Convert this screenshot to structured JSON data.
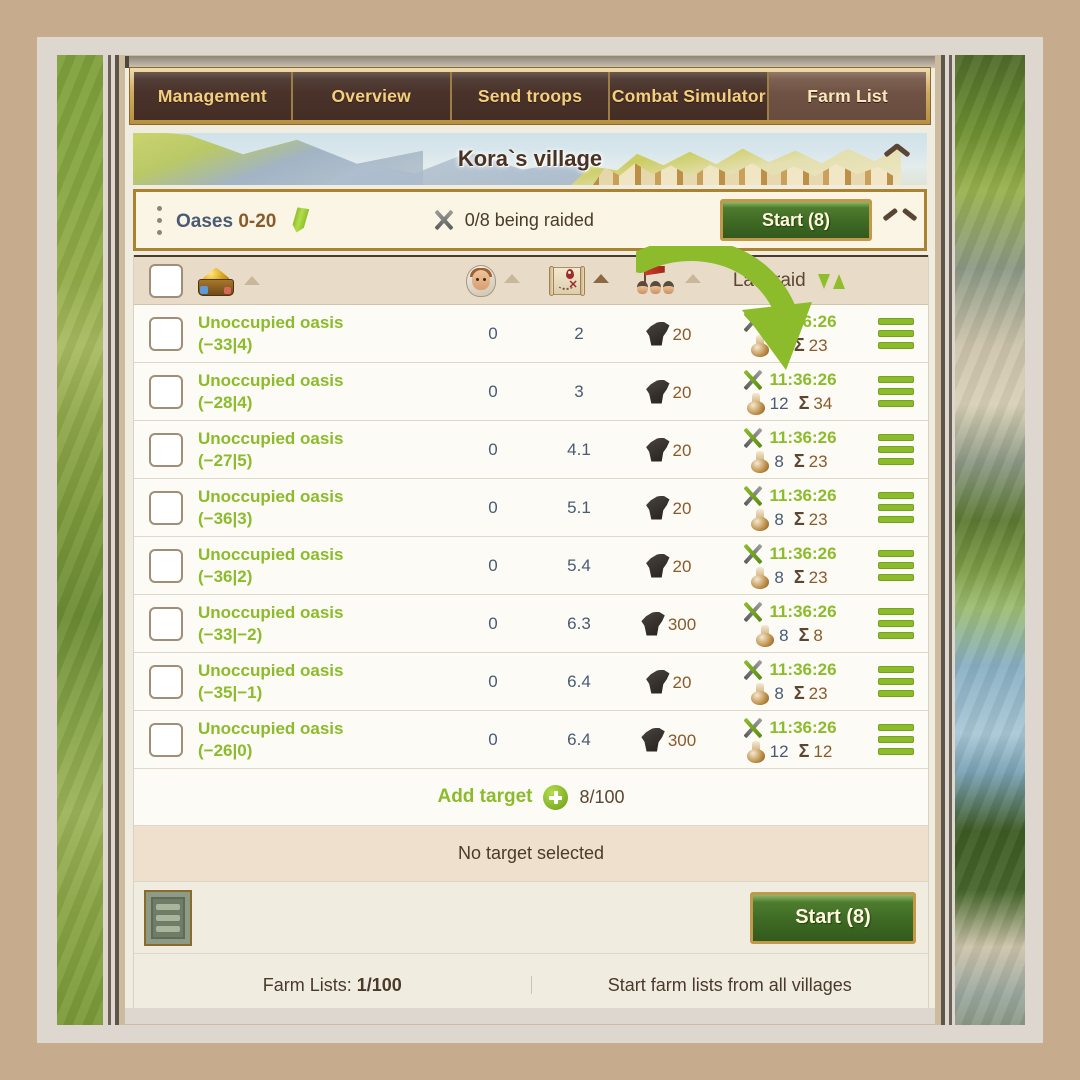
{
  "tabs": [
    {
      "label": "Management",
      "active": false
    },
    {
      "label": "Overview",
      "active": false
    },
    {
      "label": "Send troops",
      "active": false
    },
    {
      "label": "Combat Simulator",
      "active": false
    },
    {
      "label": "Farm List",
      "active": true
    }
  ],
  "banner": {
    "village_title": "Kora`s village",
    "collapse_icon": "chevron-up-icon"
  },
  "listbar": {
    "name_word": "Oases",
    "name_range": "0-20",
    "edit_icon": "pencil-icon",
    "raid_status": "0/8 being raided",
    "raid_status_icon": "crossed-swords-icon",
    "start_label": "Start (8)",
    "collapse_icon": "chevron-up-icon",
    "drag_icon": "drag-dots-icon"
  },
  "table": {
    "headers": {
      "select_all": "select-all-checkbox",
      "loot": "loot-pile-icon",
      "distance": "villager-face-icon",
      "map": "map-scroll-icon",
      "troops": "troops-flag-icon",
      "last_raid": "Last raid",
      "sort_icon": "sort-updown-icon"
    },
    "rows": [
      {
        "name": "Unoccupied oasis",
        "coords": "(−33|4)",
        "loot": "0",
        "distance": "2",
        "troop_count": "20",
        "time": "11:36:26",
        "pot": "8",
        "sum": "23"
      },
      {
        "name": "Unoccupied oasis",
        "coords": "(−28|4)",
        "loot": "0",
        "distance": "3",
        "troop_count": "20",
        "time": "11:36:26",
        "pot": "12",
        "sum": "34"
      },
      {
        "name": "Unoccupied oasis",
        "coords": "(−27|5)",
        "loot": "0",
        "distance": "4.1",
        "troop_count": "20",
        "time": "11:36:26",
        "pot": "8",
        "sum": "23"
      },
      {
        "name": "Unoccupied oasis",
        "coords": "(−36|3)",
        "loot": "0",
        "distance": "5.1",
        "troop_count": "20",
        "time": "11:36:26",
        "pot": "8",
        "sum": "23"
      },
      {
        "name": "Unoccupied oasis",
        "coords": "(−36|2)",
        "loot": "0",
        "distance": "5.4",
        "troop_count": "20",
        "time": "11:36:26",
        "pot": "8",
        "sum": "23"
      },
      {
        "name": "Unoccupied oasis",
        "coords": "(−33|−2)",
        "loot": "0",
        "distance": "6.3",
        "troop_count": "300",
        "time": "11:36:26",
        "pot": "8",
        "sum": "8"
      },
      {
        "name": "Unoccupied oasis",
        "coords": "(−35|−1)",
        "loot": "0",
        "distance": "6.4",
        "troop_count": "20",
        "time": "11:36:26",
        "pot": "8",
        "sum": "23"
      },
      {
        "name": "Unoccupied oasis",
        "coords": "(−26|0)",
        "loot": "0",
        "distance": "6.4",
        "troop_count": "300",
        "time": "11:36:26",
        "pot": "12",
        "sum": "12"
      }
    ]
  },
  "add_target": {
    "label": "Add target",
    "icon": "plus-circle-icon",
    "count": "8/100"
  },
  "selection_status": "No target selected",
  "action_bar": {
    "list_toggle_icon": "list-view-icon",
    "start_label": "Start (8)"
  },
  "footer": {
    "farm_lists_label": "Farm Lists:",
    "farm_lists_value": "1/100",
    "all_villages_label": "Start farm lists from all villages"
  },
  "annotation": {
    "arrow_icon": "curved-arrow-icon",
    "arrow_color": "#8cbb2c"
  },
  "colors": {
    "accent_green": "#8cbb2c",
    "gold": "#c09a4a",
    "tab_brown": "#432d25",
    "panel_bg": "#f0ece0"
  }
}
